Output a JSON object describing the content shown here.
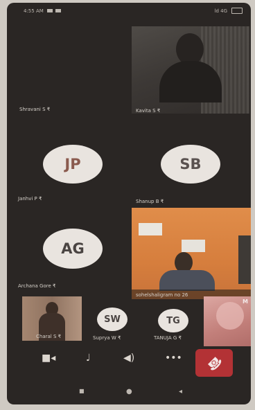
{
  "status_bar": {
    "time": "4:55 AM",
    "right_text": "ld 4G"
  },
  "participants": {
    "shravani": {
      "name": "Shravani S ₹"
    },
    "kavita": {
      "name": "Kavita S ₹"
    },
    "janhvi": {
      "name": "Janhvi P ₹",
      "initials": "JP"
    },
    "shanup": {
      "name": "Shanup B ₹",
      "initials": "SB"
    },
    "archana": {
      "name": "Archana Gore ₹",
      "initials": "AG"
    },
    "room": {
      "name": "sohelshaligram no 26"
    },
    "charal": {
      "name": "Charal S ₹"
    },
    "suprya": {
      "name": "Suprya W ₹",
      "initials": "SW"
    },
    "tanuja": {
      "name": "TANUJA G ₹",
      "initials": "TG"
    },
    "self": {
      "logo": "M"
    }
  },
  "controls": {
    "video_icon": "■◂",
    "mic_icon": "♩",
    "speaker_icon": "◀)",
    "more_icon": "•••",
    "end_icon": "☎"
  },
  "nav_bar": {
    "back": "◂",
    "home": "●",
    "recent": "■"
  },
  "colors": {
    "end_call": "#b33235",
    "background": "#2a2624",
    "avatar": "#e9e4df"
  }
}
